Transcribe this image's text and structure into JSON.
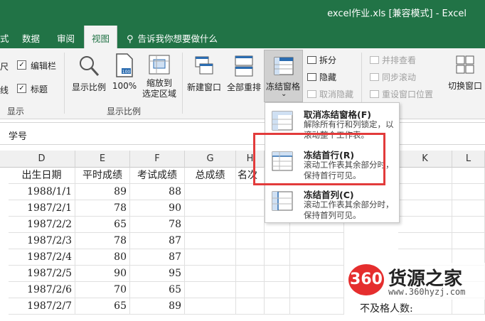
{
  "window": {
    "title": "excel作业.xls  [兼容模式]  -  Excel"
  },
  "tabs": [
    {
      "label": "式"
    },
    {
      "label": "数据"
    },
    {
      "label": "审阅"
    },
    {
      "label": "视图"
    }
  ],
  "tell_me": "告诉我你想要做什么",
  "ribbon": {
    "show": {
      "items": [
        {
          "label": "编辑栏",
          "checked": true
        },
        {
          "label": "标题",
          "checked": true
        }
      ],
      "left_partial": [
        "尺",
        "线"
      ],
      "group_label": "显示"
    },
    "zoom": {
      "buttons": [
        "显示比例",
        "100%",
        "缩放到",
        "选定区域"
      ],
      "group_label": "显示比例"
    },
    "window": {
      "new_window": "新建窗口",
      "arrange_all": "全部重排",
      "freeze_panes": "冻结窗格",
      "split": "拆分",
      "hide": "隐藏",
      "unhide": "取消隐藏",
      "side_by_side": "并排查看",
      "sync_scroll": "同步滚动",
      "reset_position": "重设窗口位置",
      "switch_windows": "切换窗口"
    }
  },
  "formula_bar": {
    "value": "学号"
  },
  "freeze_menu": [
    {
      "title": "取消冻结窗格(F)",
      "desc": "解除所有行和列锁定，以滚动整个工作表。"
    },
    {
      "title": "冻结首行(R)",
      "desc": "滚动工作表其余部分时，保持首行可见。"
    },
    {
      "title": "冻结首列(C)",
      "desc": "滚动工作表其余部分时，保持首列可见。"
    }
  ],
  "sheet": {
    "columns": [
      "D",
      "E",
      "F",
      "G",
      "H",
      "K",
      "L"
    ],
    "header_row": [
      "出生日期",
      "平时成绩",
      "考试成绩",
      "总成绩",
      "名次"
    ],
    "rows": [
      [
        "1988/1/1",
        "89",
        "88"
      ],
      [
        "1987/2/1",
        "78",
        "90"
      ],
      [
        "1987/2/2",
        "65",
        "78"
      ],
      [
        "1987/2/3",
        "78",
        "87"
      ],
      [
        "1987/2/4",
        "80",
        "87"
      ],
      [
        "1987/2/5",
        "90",
        "95"
      ],
      [
        "1987/2/6",
        "70",
        "65"
      ],
      [
        "1987/2/7",
        "65",
        "89"
      ]
    ],
    "partial_text": "不及格人数:"
  },
  "watermark": {
    "badge": "360",
    "brand": "货源之家",
    "site": "www.360hyzj.com"
  },
  "colors": {
    "excel_green": "#217346",
    "highlight_red": "#e23b3b"
  }
}
